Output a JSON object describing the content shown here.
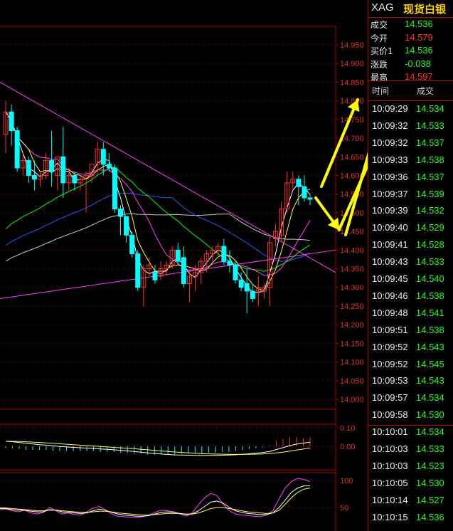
{
  "quote_panel": {
    "symbol": "XAG",
    "name": "现货白银",
    "rows": [
      {
        "label": "成交",
        "value": "14.536",
        "color": "#20ff20"
      },
      {
        "label": "今开",
        "value": "14.579",
        "color": "#ff3030"
      },
      {
        "label": "买价1",
        "value": "14.536",
        "color": "#20ff20"
      },
      {
        "label": "涨跌",
        "value": "-0.038",
        "color": "#20ff20"
      },
      {
        "label": "最高",
        "value": "14.597",
        "color": "#ff3030"
      }
    ],
    "trade_headers": {
      "time": "时间",
      "price": "成交"
    },
    "trades": [
      {
        "time": "10:09:29",
        "price": "14.534"
      },
      {
        "time": "10:09:32",
        "price": "14.533"
      },
      {
        "time": "10:09:32",
        "price": "14.537"
      },
      {
        "time": "10:09:33",
        "price": "14.538"
      },
      {
        "time": "10:09:36",
        "price": "14.537"
      },
      {
        "time": "10:09:37",
        "price": "14.539"
      },
      {
        "time": "10:09:39",
        "price": "14.532"
      },
      {
        "time": "10:09:40",
        "price": "14.529"
      },
      {
        "time": "10:09:41",
        "price": "14.528"
      },
      {
        "time": "10:09:43",
        "price": "14.533"
      },
      {
        "time": "10:09:45",
        "price": "14.540"
      },
      {
        "time": "10:09:46",
        "price": "14.538"
      },
      {
        "time": "10:09:48",
        "price": "14.541"
      },
      {
        "time": "10:09:51",
        "price": "14.538"
      },
      {
        "time": "10:09:52",
        "price": "14.543"
      },
      {
        "time": "10:09:52",
        "price": "14.545"
      },
      {
        "time": "10:09:53",
        "price": "14.543"
      },
      {
        "time": "10:09:57",
        "price": "14.534"
      },
      {
        "time": "10:09:58",
        "price": "14.530"
      },
      {
        "time": "10:10:01",
        "price": "14.534"
      },
      {
        "time": "10:10:03",
        "price": "14.533"
      },
      {
        "time": "10:10:03",
        "price": "14.523"
      },
      {
        "time": "10:10:05",
        "price": "14.530"
      },
      {
        "time": "10:10:14",
        "price": "14.527"
      },
      {
        "time": "10:10:15",
        "price": "14.536"
      }
    ]
  },
  "chart_data": [
    {
      "type": "candlestick",
      "y_ticks": [
        "14.950",
        "14.900",
        "14.850",
        "14.800",
        "14.750",
        "14.700",
        "14.650",
        "14.600",
        "14.550",
        "14.500",
        "14.450",
        "14.400",
        "14.350",
        "14.300",
        "14.250",
        "14.200",
        "14.150",
        "14.100",
        "14.050",
        "14.000"
      ],
      "ylim": [
        13.98,
        15.02
      ],
      "grid": true,
      "colors": {
        "up": "#ff3030",
        "down": "#00ffff",
        "ma_short": "#ffffff",
        "ma_mid": "#ffff40",
        "ma_long1": "#ff40ff",
        "ma_long2": "#00ff00",
        "ma_long3": "#3050ff",
        "ma_long4": "#c8c8c8",
        "trendline": "#ff40ff",
        "annotation": "#ffff00"
      },
      "candles": [
        {
          "o": 14.71,
          "h": 14.8,
          "l": 14.66,
          "c": 14.77
        },
        {
          "o": 14.77,
          "h": 14.79,
          "l": 14.68,
          "c": 14.72
        },
        {
          "o": 14.72,
          "h": 14.73,
          "l": 14.61,
          "c": 14.62
        },
        {
          "o": 14.62,
          "h": 14.66,
          "l": 14.6,
          "c": 14.64
        },
        {
          "o": 14.64,
          "h": 14.65,
          "l": 14.58,
          "c": 14.6
        },
        {
          "o": 14.6,
          "h": 14.64,
          "l": 14.56,
          "c": 14.59
        },
        {
          "o": 14.59,
          "h": 14.61,
          "l": 14.57,
          "c": 14.6
        },
        {
          "o": 14.6,
          "h": 14.66,
          "l": 14.59,
          "c": 14.64
        },
        {
          "o": 14.64,
          "h": 14.72,
          "l": 14.57,
          "c": 14.61
        },
        {
          "o": 14.6,
          "h": 14.63,
          "l": 14.56,
          "c": 14.65
        },
        {
          "o": 14.65,
          "h": 14.73,
          "l": 14.54,
          "c": 14.58
        },
        {
          "o": 14.58,
          "h": 14.62,
          "l": 14.56,
          "c": 14.6
        },
        {
          "o": 14.6,
          "h": 14.61,
          "l": 14.56,
          "c": 14.58
        },
        {
          "o": 14.58,
          "h": 14.6,
          "l": 14.56,
          "c": 14.59
        },
        {
          "o": 14.59,
          "h": 14.61,
          "l": 14.5,
          "c": 14.6
        },
        {
          "o": 14.6,
          "h": 14.62,
          "l": 14.58,
          "c": 14.63
        },
        {
          "o": 14.63,
          "h": 14.69,
          "l": 14.6,
          "c": 14.67
        },
        {
          "o": 14.67,
          "h": 14.69,
          "l": 14.6,
          "c": 14.63
        },
        {
          "o": 14.63,
          "h": 14.66,
          "l": 14.61,
          "c": 14.62
        },
        {
          "o": 14.62,
          "h": 14.63,
          "l": 14.5,
          "c": 14.51
        },
        {
          "o": 14.51,
          "h": 14.52,
          "l": 14.44,
          "c": 14.49
        },
        {
          "o": 14.49,
          "h": 14.49,
          "l": 14.42,
          "c": 14.44
        },
        {
          "o": 14.44,
          "h": 14.45,
          "l": 14.38,
          "c": 14.39
        },
        {
          "o": 14.39,
          "h": 14.4,
          "l": 14.29,
          "c": 14.3
        },
        {
          "o": 14.3,
          "h": 14.36,
          "l": 14.25,
          "c": 14.35
        },
        {
          "o": 14.35,
          "h": 14.38,
          "l": 14.33,
          "c": 14.36
        },
        {
          "o": 14.34,
          "h": 14.36,
          "l": 14.31,
          "c": 14.32
        },
        {
          "o": 14.33,
          "h": 14.37,
          "l": 14.32,
          "c": 14.35
        },
        {
          "o": 14.35,
          "h": 14.37,
          "l": 14.33,
          "c": 14.36
        },
        {
          "o": 14.36,
          "h": 14.41,
          "l": 14.35,
          "c": 14.4
        },
        {
          "o": 14.4,
          "h": 14.42,
          "l": 14.36,
          "c": 14.37
        },
        {
          "o": 14.38,
          "h": 14.41,
          "l": 14.3,
          "c": 14.31
        },
        {
          "o": 14.31,
          "h": 14.35,
          "l": 14.26,
          "c": 14.33
        },
        {
          "o": 14.33,
          "h": 14.36,
          "l": 14.29,
          "c": 14.34
        },
        {
          "o": 14.34,
          "h": 14.38,
          "l": 14.31,
          "c": 14.37
        },
        {
          "o": 14.37,
          "h": 14.4,
          "l": 14.34,
          "c": 14.39
        },
        {
          "o": 14.39,
          "h": 14.41,
          "l": 14.37,
          "c": 14.4
        },
        {
          "o": 14.4,
          "h": 14.42,
          "l": 14.38,
          "c": 14.41
        },
        {
          "o": 14.41,
          "h": 14.43,
          "l": 14.36,
          "c": 14.37
        },
        {
          "o": 14.37,
          "h": 14.4,
          "l": 14.34,
          "c": 14.36
        },
        {
          "o": 14.36,
          "h": 14.37,
          "l": 14.31,
          "c": 14.32
        },
        {
          "o": 14.32,
          "h": 14.34,
          "l": 14.29,
          "c": 14.3
        },
        {
          "o": 14.31,
          "h": 14.35,
          "l": 14.23,
          "c": 14.29
        },
        {
          "o": 14.29,
          "h": 14.31,
          "l": 14.26,
          "c": 14.27
        },
        {
          "o": 14.29,
          "h": 14.33,
          "l": 14.25,
          "c": 14.3
        },
        {
          "o": 14.29,
          "h": 14.31,
          "l": 14.27,
          "c": 14.3
        },
        {
          "o": 14.3,
          "h": 14.44,
          "l": 14.25,
          "c": 14.42
        },
        {
          "o": 14.43,
          "h": 14.47,
          "l": 14.41,
          "c": 14.45
        },
        {
          "o": 14.44,
          "h": 14.53,
          "l": 14.42,
          "c": 14.51
        },
        {
          "o": 14.51,
          "h": 14.61,
          "l": 14.5,
          "c": 14.58
        },
        {
          "o": 14.58,
          "h": 14.61,
          "l": 14.56,
          "c": 14.59
        },
        {
          "o": 14.59,
          "h": 14.6,
          "l": 14.52,
          "c": 14.57
        },
        {
          "o": 14.57,
          "h": 14.6,
          "l": 14.53,
          "c": 14.54
        },
        {
          "o": 14.54,
          "h": 14.55,
          "l": 14.52,
          "c": 14.536
        }
      ]
    },
    {
      "type": "bar",
      "y_ticks": [
        "0.10",
        "0.00"
      ],
      "ylim": [
        -0.06,
        0.12
      ],
      "values": [
        -0.01,
        -0.01,
        -0.015,
        -0.02,
        -0.02,
        -0.02,
        -0.02,
        -0.025,
        -0.025,
        -0.025,
        -0.025,
        -0.025,
        -0.025,
        -0.025,
        -0.03,
        -0.03,
        -0.03,
        -0.035,
        -0.035,
        -0.04,
        -0.04,
        -0.045,
        -0.045,
        -0.045,
        -0.045,
        -0.045,
        -0.04,
        -0.04,
        -0.04,
        -0.04,
        -0.035,
        -0.035,
        -0.03,
        -0.03,
        -0.025,
        -0.02,
        -0.015,
        -0.01,
        -0.005,
        0.005,
        0.03,
        0.04,
        0.05,
        0.05,
        0.045,
        0.05
      ],
      "colors": {
        "up": "#ff3030",
        "down": "#00ffff",
        "line1": "#ffffff",
        "line2": "#ffff40"
      }
    },
    {
      "type": "line",
      "y_ticks": [
        "100",
        "50"
      ],
      "ylim": [
        30,
        110
      ],
      "series": [
        {
          "color": "#ff40ff",
          "values": [
            46,
            47,
            44,
            42,
            45,
            40,
            38,
            41,
            50,
            44,
            38,
            40,
            37,
            36,
            42,
            49,
            52,
            46,
            38,
            34,
            33,
            32,
            31,
            33,
            36,
            41,
            45,
            44,
            42,
            38,
            34,
            40,
            55,
            68,
            76,
            72,
            56,
            44,
            38,
            36,
            35,
            34,
            33,
            36,
            44,
            66,
            86,
            98,
            104,
            102,
            98
          ]
        },
        {
          "color": "#ffff40",
          "values": [
            50,
            49,
            48,
            47,
            46,
            45,
            44,
            44,
            45,
            45,
            44,
            43,
            42,
            41,
            41,
            42,
            43,
            43,
            42,
            40,
            39,
            38,
            37,
            36,
            36,
            37,
            38,
            39,
            39,
            39,
            38,
            38,
            40,
            44,
            48,
            50,
            50,
            48,
            46,
            44,
            42,
            41,
            40,
            39,
            40,
            45,
            56,
            68,
            78,
            84,
            86
          ]
        },
        {
          "color": "#ffffff",
          "values": [
            48,
            48,
            46,
            45,
            45,
            43,
            42,
            42,
            46,
            45,
            42,
            41,
            40,
            39,
            40,
            44,
            47,
            45,
            41,
            38,
            36,
            35,
            34,
            34,
            35,
            38,
            41,
            42,
            41,
            39,
            37,
            38,
            44,
            52,
            60,
            62,
            58,
            50,
            44,
            41,
            39,
            38,
            37,
            37,
            40,
            50,
            64,
            78,
            86,
            90,
            90
          ]
        }
      ]
    }
  ]
}
